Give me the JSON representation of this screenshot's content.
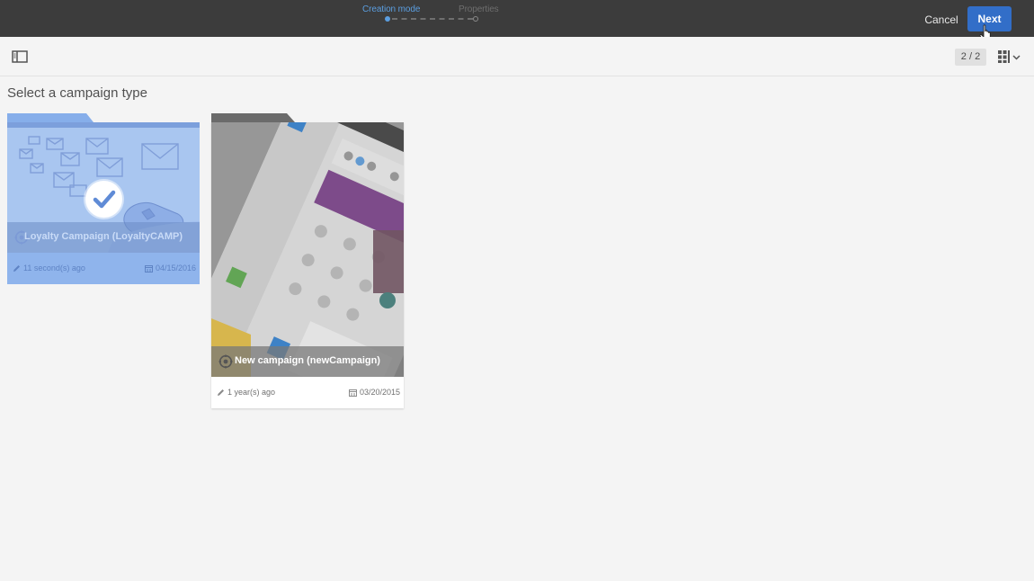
{
  "topbar": {
    "steps": [
      {
        "label": "Creation mode",
        "active": true
      },
      {
        "label": "Properties",
        "active": false
      }
    ],
    "cancel_label": "Cancel",
    "next_label": "Next"
  },
  "toolbar": {
    "page_count": "2 / 2"
  },
  "page": {
    "title": "Select a campaign type"
  },
  "cards": [
    {
      "title": "Loyalty Campaign (LoyaltyCAMP)",
      "modified": "11 second(s) ago",
      "date": "04/15/2016",
      "selected": true
    },
    {
      "title": "New campaign (newCampaign)",
      "modified": "1 year(s) ago",
      "date": "03/20/2015",
      "selected": false
    }
  ],
  "colors": {
    "topbar": "#3c3c3c",
    "accent": "#326ec8",
    "step_active": "#5b9ee0",
    "selected_card": "#8fb4ec"
  },
  "icons": [
    "panel-toggle-icon",
    "grid-view-icon",
    "chevron-down-icon",
    "checkmark-icon",
    "campaign-type-icon",
    "pencil-icon",
    "calendar-icon",
    "hand-cursor-icon"
  ]
}
